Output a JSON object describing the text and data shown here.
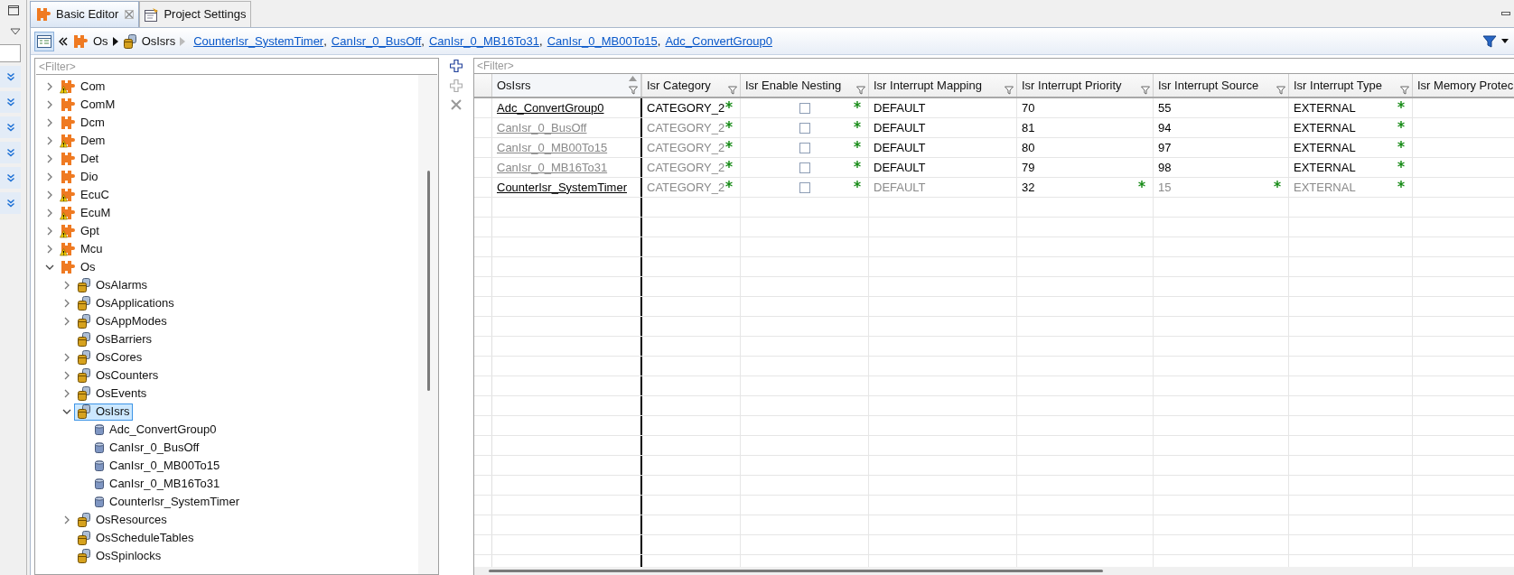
{
  "editor_tabs": [
    {
      "label": "Basic Editor",
      "selected": true
    },
    {
      "label": "Project Settings",
      "selected": false
    }
  ],
  "breadcrumb": {
    "path": [
      {
        "label": "Os",
        "kind": "module"
      },
      {
        "label": "OsIsrs",
        "kind": "container"
      }
    ],
    "separator": ",",
    "links": [
      "CounterIsr_SystemTimer",
      "CanIsr_0_BusOff",
      "CanIsr_0_MB16To31",
      "CanIsr_0_MB00To15",
      "Adc_ConvertGroup0"
    ]
  },
  "tree": {
    "filter_placeholder": "<Filter>",
    "items": [
      {
        "label": "Com",
        "kind": "module",
        "warning": true,
        "expanded": false,
        "selected": false
      },
      {
        "label": "ComM",
        "kind": "module",
        "warning": false,
        "expanded": false,
        "selected": false
      },
      {
        "label": "Dcm",
        "kind": "module",
        "warning": false,
        "expanded": false,
        "selected": false
      },
      {
        "label": "Dem",
        "kind": "module",
        "warning": true,
        "expanded": false,
        "selected": false
      },
      {
        "label": "Det",
        "kind": "module",
        "warning": false,
        "expanded": false,
        "selected": false
      },
      {
        "label": "Dio",
        "kind": "module",
        "warning": false,
        "expanded": false,
        "selected": false
      },
      {
        "label": "EcuC",
        "kind": "module",
        "warning": true,
        "expanded": false,
        "selected": false
      },
      {
        "label": "EcuM",
        "kind": "module",
        "warning": true,
        "expanded": false,
        "selected": false
      },
      {
        "label": "Gpt",
        "kind": "module",
        "warning": true,
        "expanded": false,
        "selected": false
      },
      {
        "label": "Mcu",
        "kind": "module",
        "warning": true,
        "expanded": false,
        "selected": false
      },
      {
        "label": "Os",
        "kind": "module",
        "warning": false,
        "expanded": true,
        "selected": false,
        "children": [
          {
            "label": "OsAlarms",
            "kind": "container",
            "expanded": false,
            "selected": false
          },
          {
            "label": "OsApplications",
            "kind": "container",
            "expanded": false,
            "selected": false
          },
          {
            "label": "OsAppModes",
            "kind": "container",
            "expanded": false,
            "selected": false
          },
          {
            "label": "OsBarriers",
            "kind": "container",
            "selected": false
          },
          {
            "label": "OsCores",
            "kind": "container",
            "expanded": false,
            "selected": false
          },
          {
            "label": "OsCounters",
            "kind": "container",
            "expanded": false,
            "selected": false
          },
          {
            "label": "OsEvents",
            "kind": "container",
            "expanded": false,
            "selected": false
          },
          {
            "label": "OsIsrs",
            "kind": "container",
            "expanded": true,
            "selected": true,
            "children": [
              {
                "label": "Adc_ConvertGroup0",
                "kind": "instance",
                "selected": false
              },
              {
                "label": "CanIsr_0_BusOff",
                "kind": "instance",
                "selected": false
              },
              {
                "label": "CanIsr_0_MB00To15",
                "kind": "instance",
                "selected": false
              },
              {
                "label": "CanIsr_0_MB16To31",
                "kind": "instance",
                "selected": false
              },
              {
                "label": "CounterIsr_SystemTimer",
                "kind": "instance",
                "selected": false
              }
            ]
          },
          {
            "label": "OsResources",
            "kind": "container",
            "expanded": false,
            "selected": false
          },
          {
            "label": "OsScheduleTables",
            "kind": "container",
            "selected": false
          },
          {
            "label": "OsSpinlocks",
            "kind": "container",
            "selected": false
          }
        ]
      }
    ]
  },
  "table": {
    "filter_placeholder": "<Filter>",
    "columns": [
      {
        "label": "OsIsrs",
        "sorted": true
      },
      {
        "label": "Isr Category"
      },
      {
        "label": "Isr Enable Nesting"
      },
      {
        "label": "Isr Interrupt Mapping"
      },
      {
        "label": "Isr Interrupt Priority"
      },
      {
        "label": "Isr Interrupt Source"
      },
      {
        "label": "Isr Interrupt Type"
      },
      {
        "label": "Isr Memory Protec"
      }
    ],
    "rows": [
      {
        "cells": [
          {
            "kind": "link",
            "text": "Adc_ConvertGroup0",
            "dimmed": false,
            "modified": false
          },
          {
            "kind": "text",
            "text": "CATEGORY_2",
            "dimmed": false,
            "modified": true
          },
          {
            "kind": "checkbox",
            "checked": false,
            "modified": true
          },
          {
            "kind": "text",
            "text": "DEFAULT",
            "dimmed": false,
            "modified": false
          },
          {
            "kind": "text",
            "text": "70",
            "dimmed": false,
            "modified": false
          },
          {
            "kind": "text",
            "text": "55",
            "dimmed": false,
            "modified": false
          },
          {
            "kind": "text",
            "text": "EXTERNAL",
            "dimmed": false,
            "modified": true
          }
        ]
      },
      {
        "cells": [
          {
            "kind": "link",
            "text": "CanIsr_0_BusOff",
            "dimmed": true,
            "modified": false
          },
          {
            "kind": "text",
            "text": "CATEGORY_2",
            "dimmed": true,
            "modified": true
          },
          {
            "kind": "checkbox",
            "checked": false,
            "modified": true
          },
          {
            "kind": "text",
            "text": "DEFAULT",
            "dimmed": false,
            "modified": false
          },
          {
            "kind": "text",
            "text": "81",
            "dimmed": false,
            "modified": false
          },
          {
            "kind": "text",
            "text": "94",
            "dimmed": false,
            "modified": false
          },
          {
            "kind": "text",
            "text": "EXTERNAL",
            "dimmed": false,
            "modified": true
          }
        ]
      },
      {
        "cells": [
          {
            "kind": "link",
            "text": "CanIsr_0_MB00To15",
            "dimmed": true,
            "modified": false
          },
          {
            "kind": "text",
            "text": "CATEGORY_2",
            "dimmed": true,
            "modified": true
          },
          {
            "kind": "checkbox",
            "checked": false,
            "modified": true
          },
          {
            "kind": "text",
            "text": "DEFAULT",
            "dimmed": false,
            "modified": false
          },
          {
            "kind": "text",
            "text": "80",
            "dimmed": false,
            "modified": false
          },
          {
            "kind": "text",
            "text": "97",
            "dimmed": false,
            "modified": false
          },
          {
            "kind": "text",
            "text": "EXTERNAL",
            "dimmed": false,
            "modified": true
          }
        ]
      },
      {
        "cells": [
          {
            "kind": "link",
            "text": "CanIsr_0_MB16To31",
            "dimmed": true,
            "modified": false
          },
          {
            "kind": "text",
            "text": "CATEGORY_2",
            "dimmed": true,
            "modified": true
          },
          {
            "kind": "checkbox",
            "checked": false,
            "modified": true
          },
          {
            "kind": "text",
            "text": "DEFAULT",
            "dimmed": false,
            "modified": false
          },
          {
            "kind": "text",
            "text": "79",
            "dimmed": false,
            "modified": false
          },
          {
            "kind": "text",
            "text": "98",
            "dimmed": false,
            "modified": false
          },
          {
            "kind": "text",
            "text": "EXTERNAL",
            "dimmed": false,
            "modified": true
          }
        ]
      },
      {
        "cells": [
          {
            "kind": "link",
            "text": "CounterIsr_SystemTimer",
            "dimmed": false,
            "modified": false
          },
          {
            "kind": "text",
            "text": "CATEGORY_2",
            "dimmed": true,
            "modified": true
          },
          {
            "kind": "checkbox",
            "checked": false,
            "modified": true
          },
          {
            "kind": "text",
            "text": "DEFAULT",
            "dimmed": true,
            "modified": false
          },
          {
            "kind": "text",
            "text": "32",
            "dimmed": false,
            "modified": true
          },
          {
            "kind": "text",
            "text": "15",
            "dimmed": true,
            "modified": true
          },
          {
            "kind": "text",
            "text": "EXTERNAL",
            "dimmed": true,
            "modified": true
          }
        ]
      }
    ]
  }
}
